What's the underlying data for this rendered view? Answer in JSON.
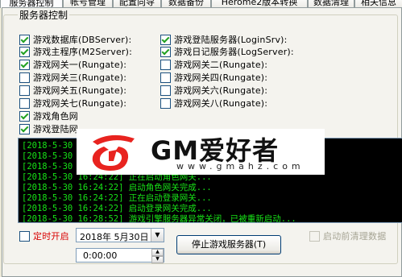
{
  "tabs": [
    {
      "label": "服务器控制"
    },
    {
      "label": "帐号管理"
    },
    {
      "label": "配置向导"
    },
    {
      "label": "数据备份"
    },
    {
      "label": "Herome2版本转换"
    },
    {
      "label": "数据清理"
    },
    {
      "label": "相关信息"
    }
  ],
  "group_title": "服务器控制",
  "checkboxes": [
    {
      "label": "游戏数据库(DBServer):",
      "checked": true
    },
    {
      "label": "游戏登陆服务器(LoginSrv):",
      "checked": true
    },
    {
      "label": "游戏主程序(M2Server):",
      "checked": true
    },
    {
      "label": "游戏日记服务器(LogServer):",
      "checked": true
    },
    {
      "label": "游戏网关一(Rungate):",
      "checked": true
    },
    {
      "label": "游戏网关二(Rungate):",
      "checked": false
    },
    {
      "label": "游戏网关三(Rungate):",
      "checked": false
    },
    {
      "label": "游戏网关四(Rungate):",
      "checked": false
    },
    {
      "label": "游戏网关五(Rungate):",
      "checked": false
    },
    {
      "label": "游戏网关六(Rungate):",
      "checked": false
    },
    {
      "label": "游戏网关七(Rungate):",
      "checked": false
    },
    {
      "label": "游戏网关八(Rungate):",
      "checked": false
    },
    {
      "label": "游戏角色网",
      "checked": true
    },
    {
      "label": "游戏登陆网",
      "checked": true
    }
  ],
  "log_lines": [
    "[2018-5-30 1",
    "[2018-5-30 1",
    "[2018-5-30 1",
    "[2018-5-30 16:24:22] 正在启动角色网关...",
    "[2018-5-30 16:24:22] 启动角色网关完成...",
    "[2018-5-30 16:24:22] 正在启动登录网关...",
    "[2018-5-30 16:24:22] 启动登录网关完成...",
    "[2018-5-30 16:28:52] 游戏引擎服务器异常关闭，已被重新启动..."
  ],
  "logo": {
    "title": "GM爱好者",
    "url": "www.gmahz.com"
  },
  "timer": {
    "label": "定时开启",
    "checked": false,
    "date": "2018年 5月30日",
    "time": "0:00:00"
  },
  "stop_button_label": "停止游戏服务器(T)",
  "pre_clean": {
    "label": "启动前清理数据",
    "checked": false
  },
  "colors": {
    "log_text": "#17e317",
    "timer_label": "#d80000",
    "logo_red": "#e8231f"
  }
}
